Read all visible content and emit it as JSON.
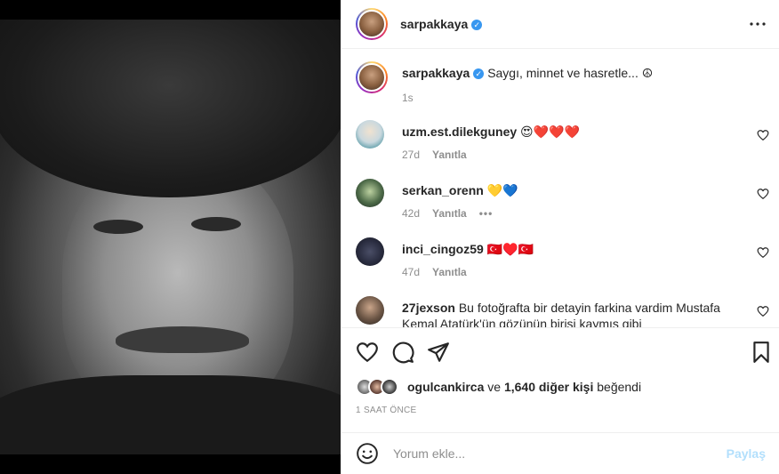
{
  "post": {
    "author": "sarpakkaya",
    "verified_mark": "✓",
    "more_icon": "more-horizontal-icon"
  },
  "caption": {
    "username": "sarpakkaya",
    "text": "Saygı, minnet ve hasretle... ☮",
    "time": "1s"
  },
  "comments": [
    {
      "username": "uzm.est.dilekguney",
      "text": "😍❤️❤️❤️",
      "age": "27d",
      "reply": "Yanıtla",
      "more": ""
    },
    {
      "username": "serkan_orenn",
      "text": "💛💙",
      "age": "42d",
      "reply": "Yanıtla",
      "more": "•••"
    },
    {
      "username": "inci_cingoz59",
      "text": "🇹🇷♥️🇹🇷",
      "age": "47d",
      "reply": "Yanıtla",
      "more": ""
    },
    {
      "username": "27jexson",
      "text": "Bu fotoğrafta bir detayin farkina vardim Mustafa Kemal Atatürk'ün gözünün birisi kaymış gibi",
      "age": "",
      "reply": "",
      "more": ""
    }
  ],
  "likes": {
    "first_user": "ogulcankirca",
    "connector": "ve",
    "others": "1,640 diğer kişi",
    "suffix": "beğendi"
  },
  "timestamp": "1 SAAT ÖNCE",
  "add_comment": {
    "placeholder": "Yorum ekle...",
    "post_label": "Paylaş"
  },
  "colors": {
    "verified": "#3897f0",
    "post_disabled": "#b2dffc",
    "secondary_text": "#8e8e8e"
  }
}
